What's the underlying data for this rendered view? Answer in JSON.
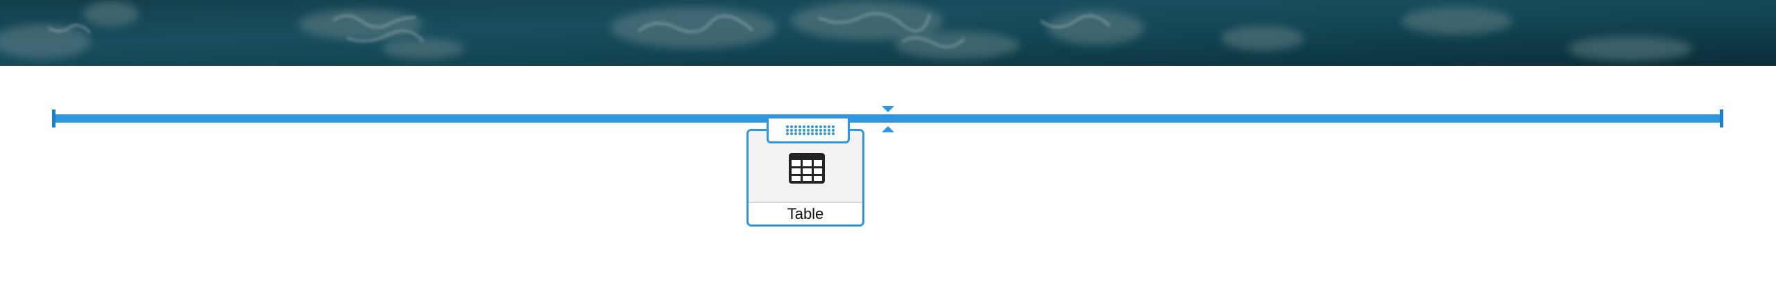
{
  "hero": {
    "icon": "ocean-photo"
  },
  "block": {
    "label": "Table",
    "icon": "table-icon",
    "accent": "#2e96e2"
  },
  "handle": {
    "icon": "drag-handle-icon"
  }
}
